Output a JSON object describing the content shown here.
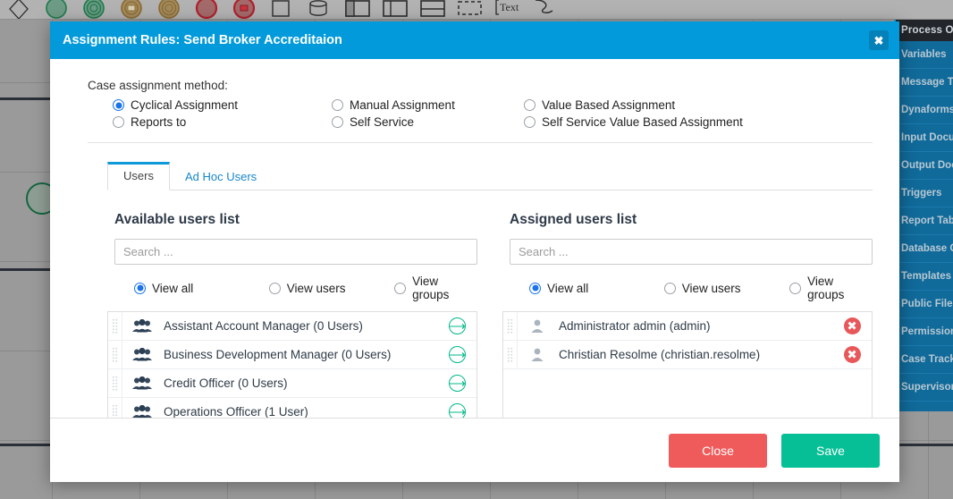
{
  "toolbar": {
    "icons": [
      "gateway-diamond-icon",
      "start-event-icon",
      "intermediate-event-icon",
      "message-event-icon",
      "timer-event-icon",
      "end-event-icon",
      "terminate-event-icon",
      "task-icon",
      "data-store-icon",
      "sub-process-icon",
      "pool-icon",
      "lane-icon",
      "group-icon",
      "text-annotation-icon",
      "connector-icon"
    ]
  },
  "right_panel": {
    "header": "Process Ob",
    "items": [
      "Variables",
      "Message Ty",
      "Dynaforms",
      "Input Docu",
      "Output Doc",
      "Triggers",
      "Report Tab",
      "Database C",
      "Templates",
      "Public Files",
      "Permission",
      "Case Track",
      "Supervisor"
    ]
  },
  "modal": {
    "title": "Assignment Rules: Send Broker Accreditaion",
    "close_icon": "close-icon",
    "method": {
      "label": "Case assignment method:",
      "options": [
        {
          "label": "Cyclical Assignment",
          "selected": true
        },
        {
          "label": "Manual Assignment",
          "selected": false
        },
        {
          "label": "Value Based Assignment",
          "selected": false
        },
        {
          "label": "Reports to",
          "selected": false
        },
        {
          "label": "Self Service",
          "selected": false
        },
        {
          "label": "Self Service Value Based Assignment",
          "selected": false
        }
      ]
    },
    "tabs": [
      {
        "label": "Users",
        "active": true
      },
      {
        "label": "Ad Hoc Users",
        "active": false
      }
    ],
    "available": {
      "title": "Available users list",
      "search_placeholder": "Search ...",
      "search_value": "",
      "filters": [
        {
          "label": "View all",
          "selected": true
        },
        {
          "label": "View users",
          "selected": false
        },
        {
          "label": "View groups",
          "selected": false
        }
      ],
      "rows": [
        {
          "icon": "group-icon",
          "label": "Assistant Account Manager (0 Users)",
          "action": "add-icon"
        },
        {
          "icon": "group-icon",
          "label": "Business Development Manager (0 Users)",
          "action": "add-icon"
        },
        {
          "icon": "group-icon",
          "label": "Credit Officer (0 Users)",
          "action": "add-icon"
        },
        {
          "icon": "group-icon",
          "label": "Operations Officer (1 User)",
          "action": "add-icon"
        }
      ]
    },
    "assigned": {
      "title": "Assigned users list",
      "search_placeholder": "Search ...",
      "search_value": "",
      "filters": [
        {
          "label": "View all",
          "selected": true
        },
        {
          "label": "View users",
          "selected": false
        },
        {
          "label": "View groups",
          "selected": false
        }
      ],
      "rows": [
        {
          "icon": "user-icon",
          "label": "Administrator admin (admin)",
          "action": "remove-icon"
        },
        {
          "icon": "user-icon",
          "label": "Christian Resolme (christian.resolme)",
          "action": "remove-icon"
        }
      ]
    },
    "footer": {
      "close_label": "Close",
      "save_label": "Save"
    }
  },
  "colors": {
    "header_blue": "#029ada",
    "tab_active_blue": "#0e9ad8",
    "link_blue": "#1787c9",
    "radio_blue": "#1a73e8",
    "add_green": "#00b88a",
    "remove_red": "#e8585a",
    "close_btn": "#ef5b5b",
    "save_btn": "#06bf96",
    "sidebar_blue": "#106a9a",
    "sidebar_header": "#22262b"
  }
}
